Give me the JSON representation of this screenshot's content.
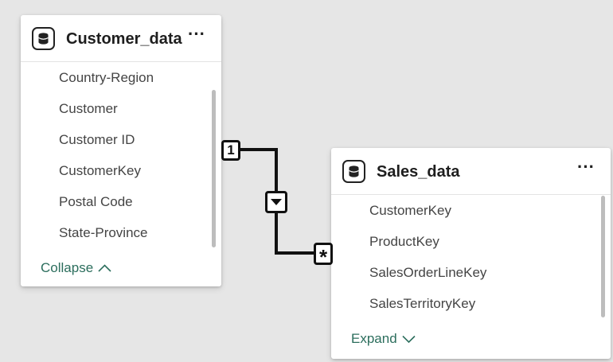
{
  "tables": [
    {
      "title": "Customer_data",
      "icon": "database-icon",
      "more_icon": "more-options-icon",
      "more_label": "···",
      "fields": [
        "Country-Region",
        "Customer",
        "Customer ID",
        "CustomerKey",
        "Postal Code",
        "State-Province"
      ],
      "toggle_label": "Collapse",
      "toggle_icon": "chevron-up-icon"
    },
    {
      "title": "Sales_data",
      "icon": "database-icon",
      "more_icon": "more-options-icon",
      "more_label": "···",
      "fields": [
        "CustomerKey",
        "ProductKey",
        "SalesOrderLineKey",
        "SalesTerritoryKey"
      ],
      "toggle_label": "Expand",
      "toggle_icon": "chevron-down-icon"
    }
  ],
  "relationship": {
    "from_table": "Customer_data",
    "to_table": "Sales_data",
    "from_cardinality": "1",
    "to_cardinality": "*",
    "direction_icon": "triangle-down-icon"
  },
  "colors": {
    "canvas": "#e6e6e6",
    "link_text": "#2c6e5d",
    "line": "#111111"
  }
}
